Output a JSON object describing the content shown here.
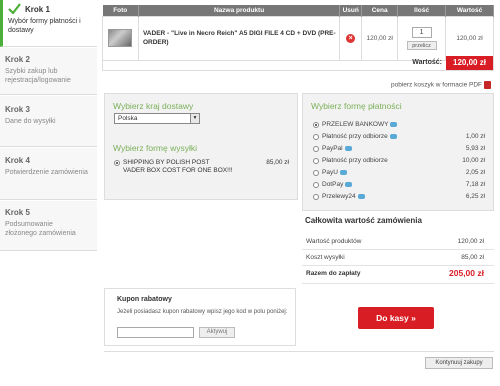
{
  "steps": [
    {
      "title": "Krok 1",
      "desc": "Wybór formy płatności i dostawy"
    },
    {
      "title": "Krok 2",
      "desc": "Szybki zakup lub rejestracja/logowanie"
    },
    {
      "title": "Krok 3",
      "desc": "Dane do wysyłki"
    },
    {
      "title": "Krok 4",
      "desc": "Potwierdzenie zamówienia"
    },
    {
      "title": "Krok 5",
      "desc": "Podsumowanie złożonego zamówienia"
    }
  ],
  "table": {
    "headers": [
      "Foto",
      "Nazwa produktu",
      "Usuń",
      "Cena",
      "Ilość",
      "Wartość"
    ],
    "product": {
      "name": "VADER - \"Live in Necro Reich\" A5 DIGI FILE 4 CD + DVD (PRE-ORDER)",
      "price": "120,00 zł",
      "quantity": "1",
      "recalc_label": "przelicz",
      "value": "120,00 zł"
    },
    "total_label": "Wartość:",
    "total_value": "120,00 zł"
  },
  "pdf_link": "pobierz koszyk w formacie PDF",
  "shipping": {
    "country_title": "Wybierz kraj dostawy",
    "country_value": "Polska",
    "method_title": "Wybierz formę wysyłki",
    "method_label": "SHIPPING BY POLISH POST VADER BOX COST FOR ONE BOX!!!",
    "method_price": "85,00 zł"
  },
  "payment": {
    "title": "Wybierz formę płatności",
    "options": [
      {
        "label": "PRZELEW BANKOWY",
        "price": ""
      },
      {
        "label": "Płatność przy odbiorze",
        "price": "1,00 zł"
      },
      {
        "label": "PayPal",
        "price": "5,93 zł"
      },
      {
        "label": "Płatność przy odbiorze",
        "price": "10,00 zł"
      },
      {
        "label": "PayU",
        "price": "2,05 zł"
      },
      {
        "label": "DotPay",
        "price": "7,18 zł"
      },
      {
        "label": "Przelewy24",
        "price": "6,25 zł"
      }
    ]
  },
  "summary": {
    "title": "Całkowita wartość zamówienia",
    "rows": [
      {
        "label": "Wartość produktów",
        "value": "120,00 zł"
      },
      {
        "label": "Koszt wysyłki",
        "value": "85,00 zł"
      },
      {
        "label": "Razem do zapłaty",
        "value": "205,00 zł"
      }
    ]
  },
  "coupon": {
    "title": "Kupon rabatowy",
    "desc": "Jeżeli posiadasz kupon rabatowy wpisz jego kod w polu poniżej:",
    "button": "Aktywuj"
  },
  "checkout_label": "Do kasy »",
  "continue_label": "Kontynuuj zakupy",
  "colors": {
    "accent_red": "#d91d24",
    "accent_green": "#7bb05a"
  }
}
